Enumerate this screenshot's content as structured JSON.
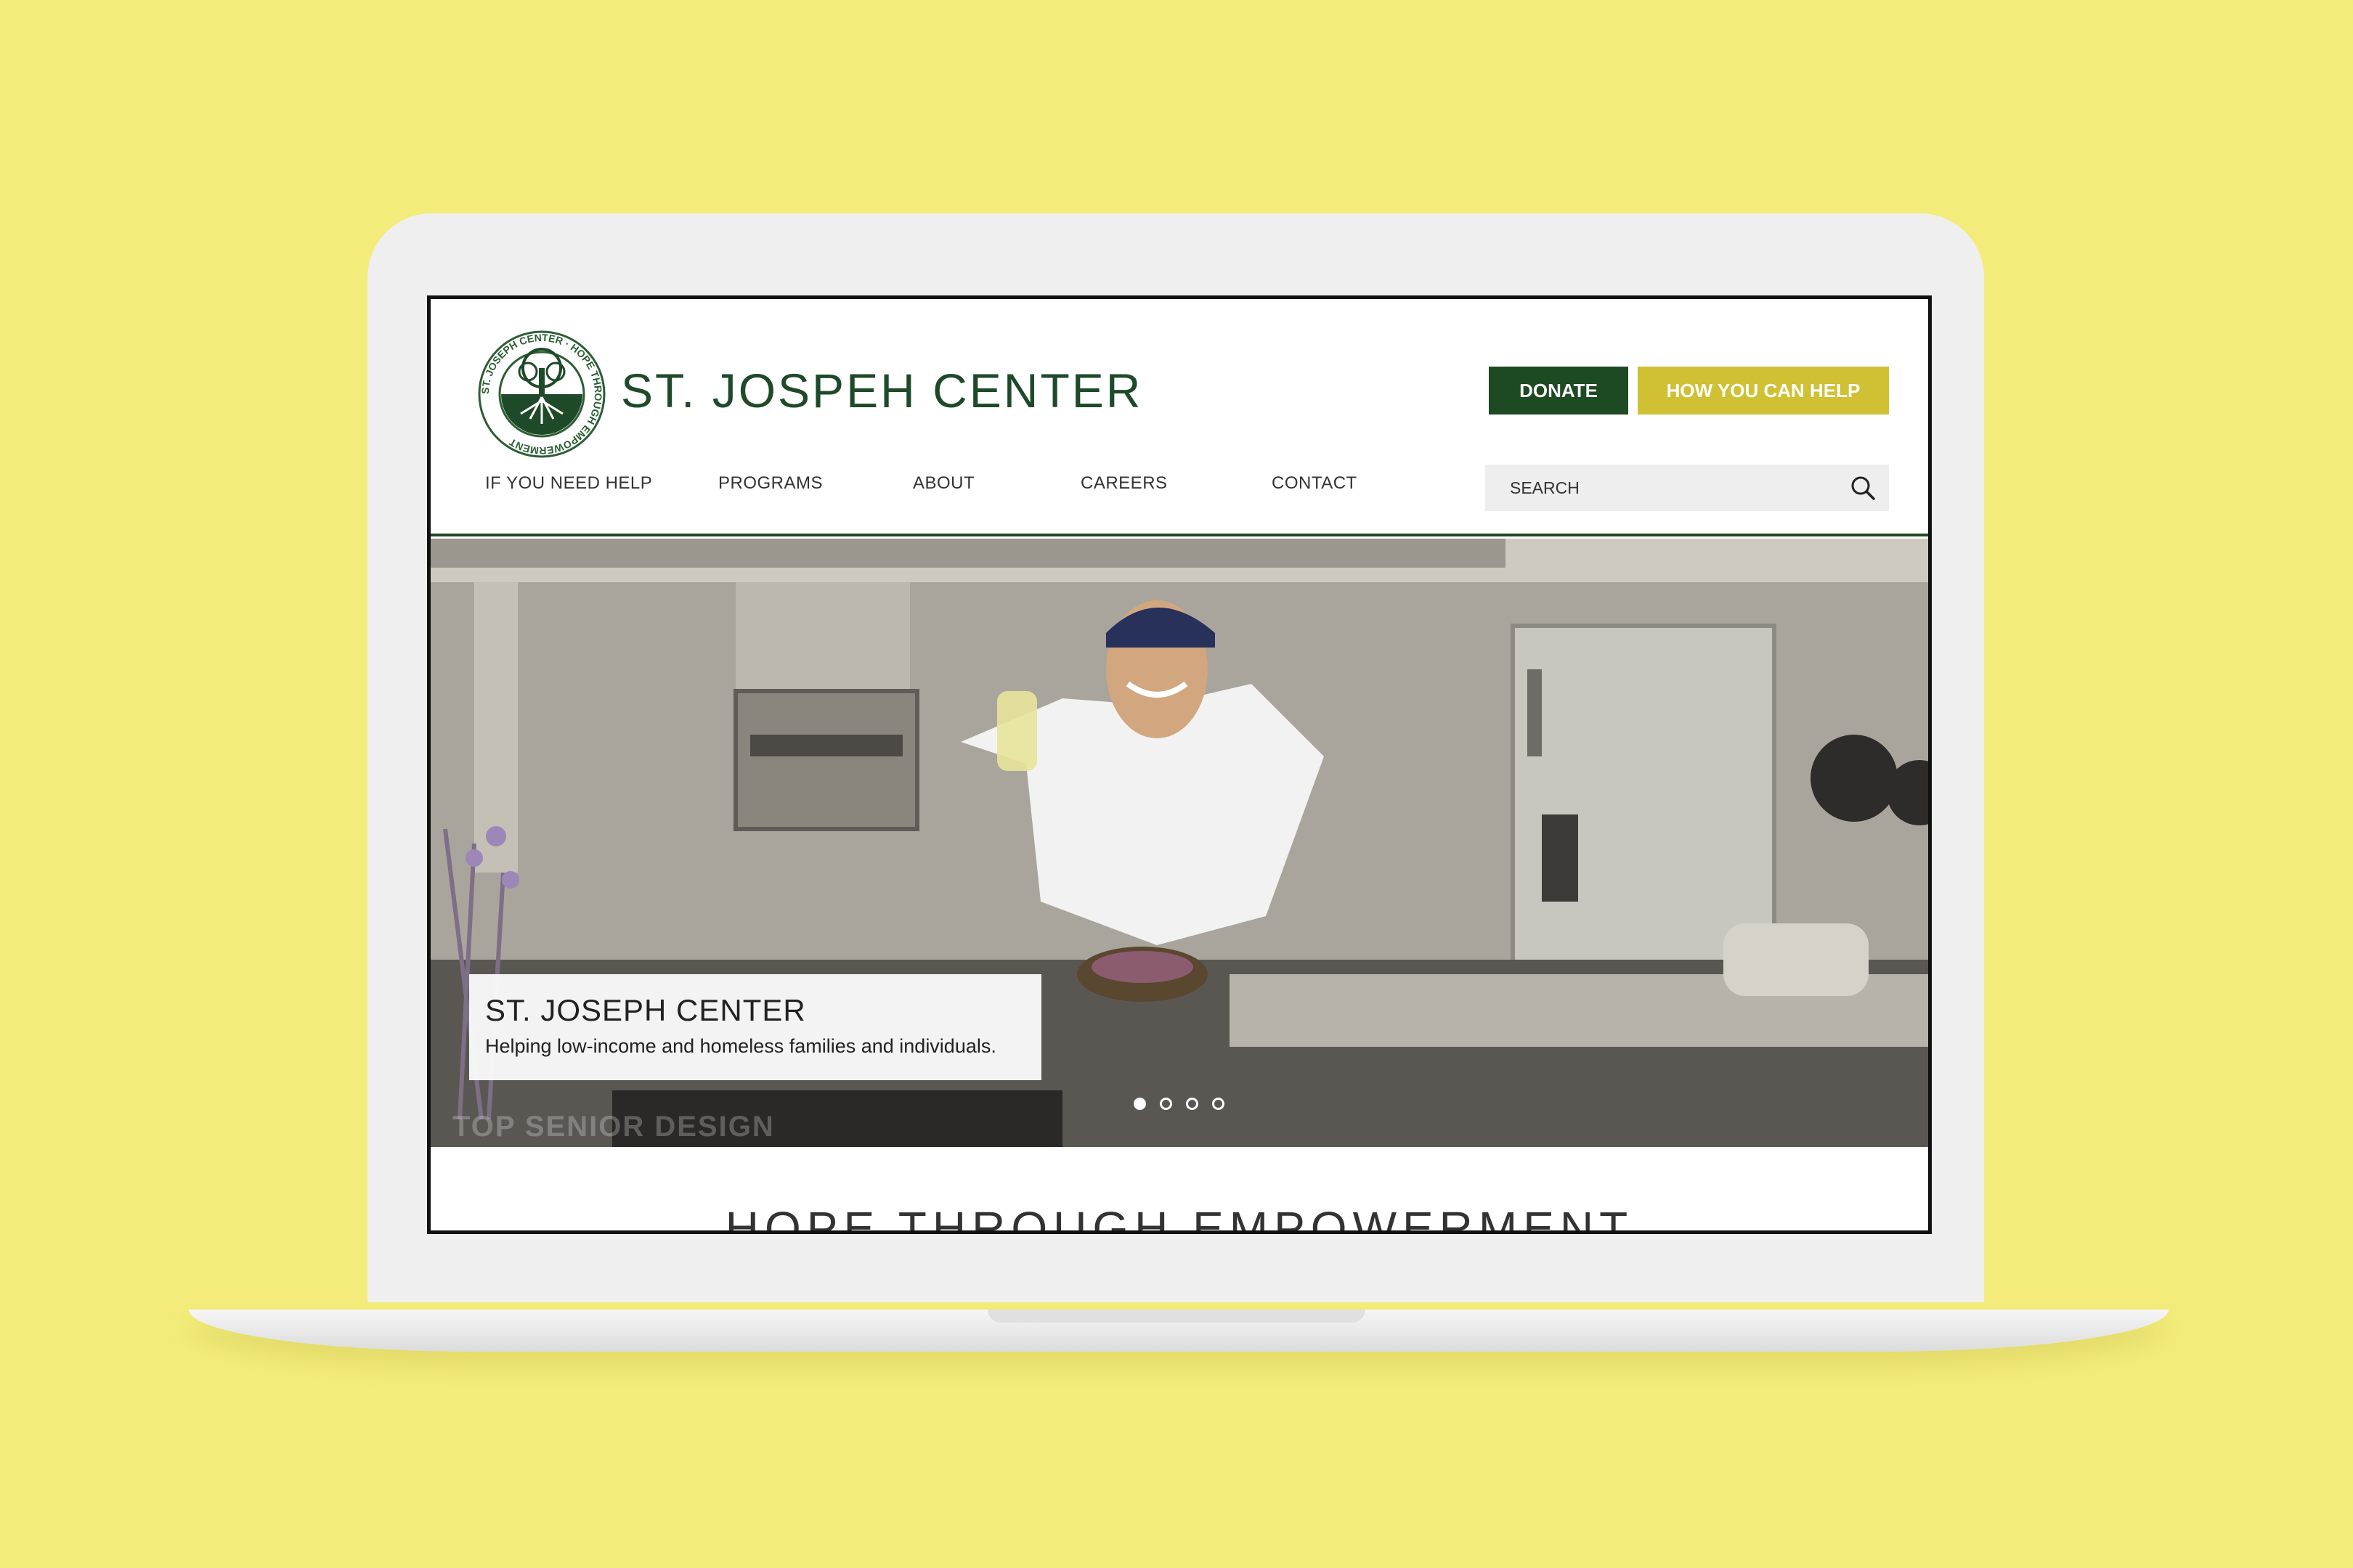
{
  "site": {
    "title": "ST. JOSPEH CENTER",
    "logo_text": "ST. JOSEPH CENTER · HOPE THROUGH EMPOWERMENT"
  },
  "header": {
    "donate_label": "DONATE",
    "help_label": "HOW YOU CAN HELP"
  },
  "nav": {
    "items": [
      {
        "label": "IF YOU NEED HELP"
      },
      {
        "label": "PROGRAMS"
      },
      {
        "label": "ABOUT"
      },
      {
        "label": "CAREERS"
      },
      {
        "label": "CONTACT"
      }
    ]
  },
  "search": {
    "placeholder": "SEARCH",
    "icon": "search-icon"
  },
  "hero": {
    "caption_title": "ST. JOSEPH CENTER",
    "caption_subtitle": "Helping low-income and homeless families and individuals.",
    "slides": 4,
    "active_slide": 1,
    "faded_text": "TOP SENIOR DESIGN"
  },
  "main": {
    "tagline": "HOPE THROUGH EMPOWERMENT"
  },
  "colors": {
    "background": "#f4ec7a",
    "brand_green": "#1d4a22",
    "brand_yellow": "#cfc133"
  }
}
